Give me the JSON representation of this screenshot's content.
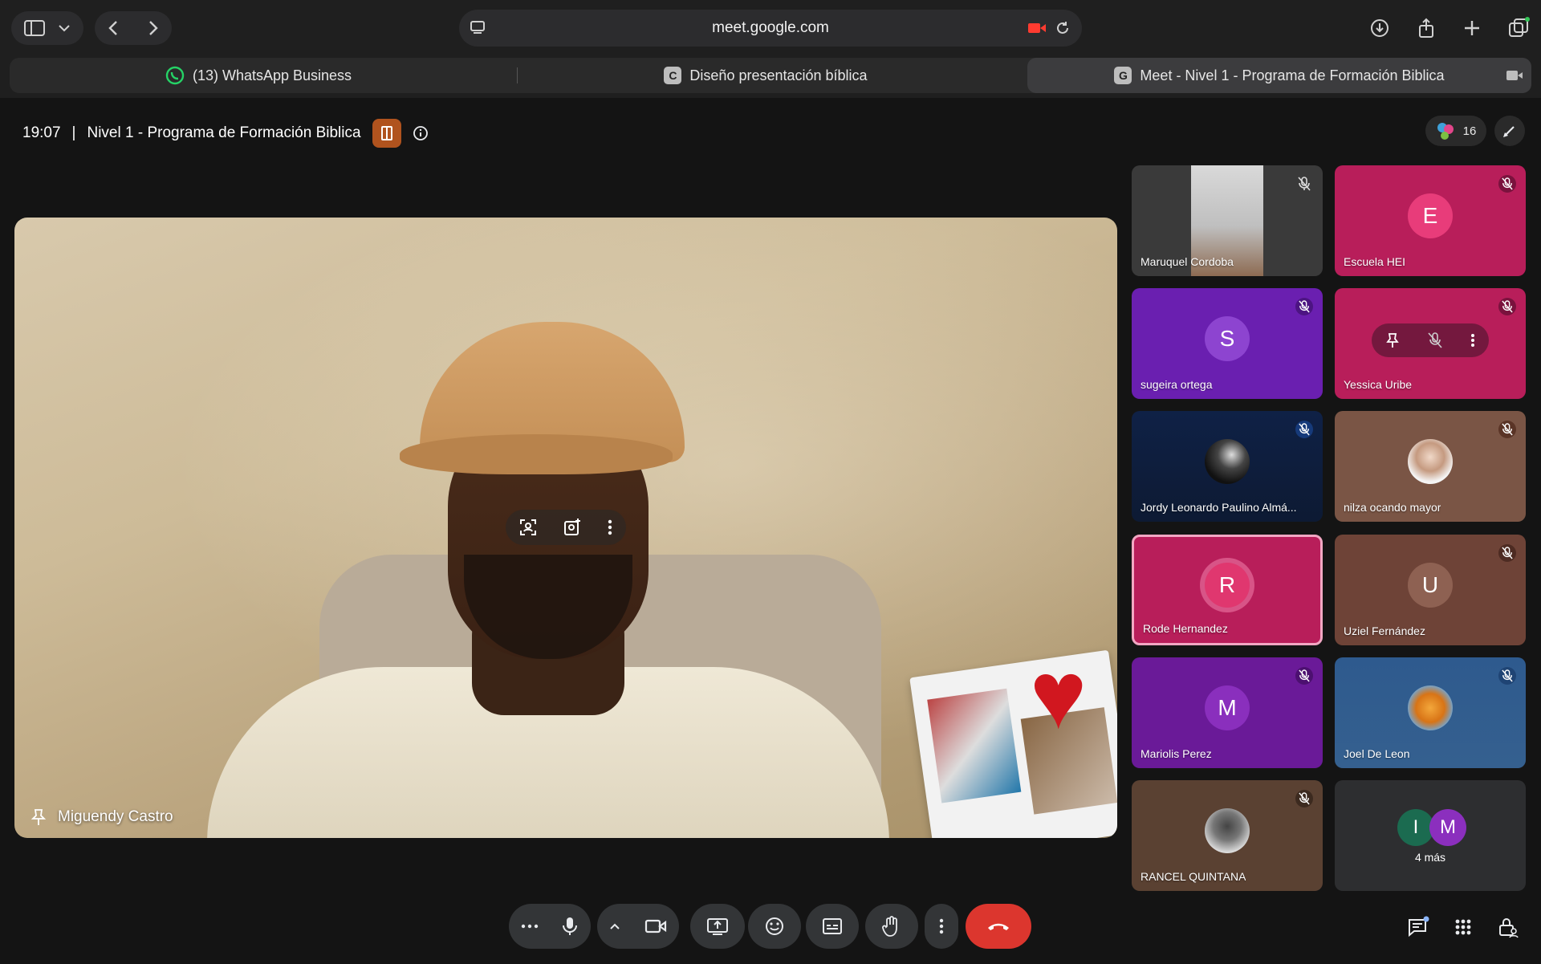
{
  "browser": {
    "url": "meet.google.com",
    "tabs": [
      {
        "label": "(13) WhatsApp Business",
        "favicon": "whatsapp-icon"
      },
      {
        "label": "Diseño presentación bíblica",
        "favicon": "C"
      },
      {
        "label": "Meet - Nivel 1 - Programa de Formación Biblica",
        "favicon": "G"
      }
    ]
  },
  "meeting": {
    "time": "19:07",
    "separator": "|",
    "title": "Nivel 1 - Programa de Formación Biblica",
    "participant_count": "16"
  },
  "main_speaker": {
    "name": "Miguendy Castro"
  },
  "participants": [
    {
      "name": "Maruquel Cordoba",
      "type": "video"
    },
    {
      "name": "Escuela HEI",
      "initial": "E"
    },
    {
      "name": "sugeira ortega",
      "initial": "S"
    },
    {
      "name": "Yessica Uribe",
      "initial": ""
    },
    {
      "name": "Jordy Leonardo Paulino Almá...",
      "type": "photo"
    },
    {
      "name": "nilza ocando mayor",
      "type": "photo"
    },
    {
      "name": "Rode Hernandez",
      "initial": "R"
    },
    {
      "name": "Uziel Fernández",
      "initial": "U"
    },
    {
      "name": "Mariolis Perez",
      "initial": "M"
    },
    {
      "name": "Joel De Leon",
      "type": "photo"
    },
    {
      "name": "RANCEL QUINTANA",
      "type": "photo"
    }
  ],
  "more_tile": {
    "initials": [
      "I",
      "M"
    ],
    "label": "4 más"
  },
  "colors": {
    "end_call": "#dc362e",
    "accent_pink": "#c2185b",
    "purple": "#7b1fa2"
  }
}
